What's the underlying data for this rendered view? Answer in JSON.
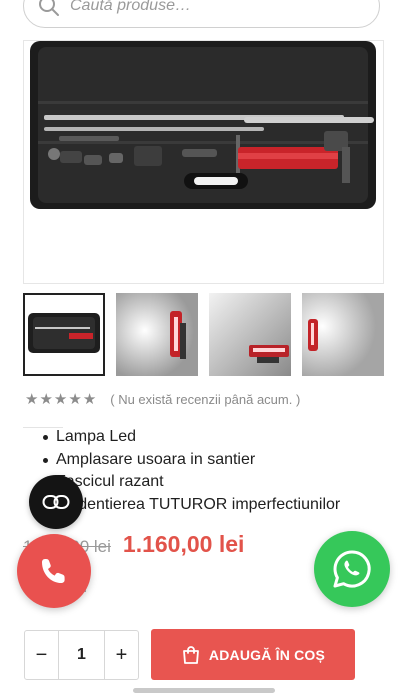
{
  "search": {
    "placeholder": "Caută produse…",
    "icon": "search-icon"
  },
  "product": {
    "main_image_alt": "search-icon",
    "thumbnails_count": 4,
    "rating": {
      "stars": 5,
      "filled": 0,
      "text": "( Nu există recenzii până acum. )"
    },
    "features": [
      "Lampa Led",
      "Amplasare usoara in santier",
      "Fascicul razant",
      "Evidentierea TUTUROR imperfectiunilor"
    ],
    "price": {
      "old": "1.450,00 lei",
      "new": "1.160,00 lei"
    },
    "mark": "i"
  },
  "cart": {
    "decrement_label": "−",
    "quantity": "1",
    "increment_label": "+",
    "add_label": "ADAUGĂ ÎN COȘ"
  },
  "colors": {
    "accent": "#e85550",
    "whatsapp": "#36c85a",
    "dark_fab": "#141414"
  }
}
